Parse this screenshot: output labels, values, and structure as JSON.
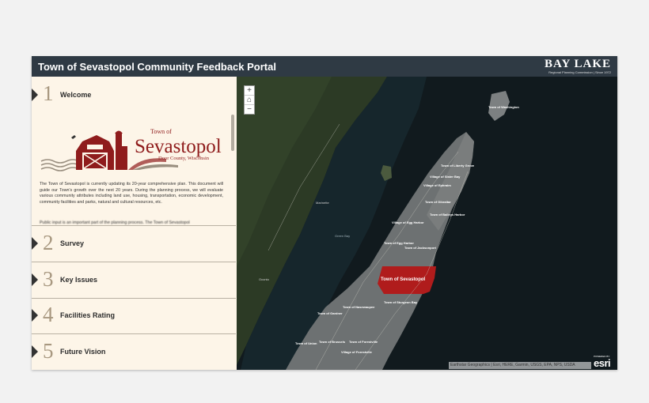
{
  "header": {
    "title": "Town of Sevastopol Community Feedback Portal",
    "logo_brand": "BAY LAKE",
    "logo_sub": "Regional Planning Commission | Since 1972"
  },
  "steps": [
    {
      "number": "1",
      "label": "Welcome"
    },
    {
      "number": "2",
      "label": "Survey"
    },
    {
      "number": "3",
      "label": "Key Issues"
    },
    {
      "number": "4",
      "label": "Facilities Rating"
    },
    {
      "number": "5",
      "label": "Future Vision"
    }
  ],
  "welcome": {
    "logo_town_of": "Town of",
    "logo_name": "Sevastopol",
    "logo_county": "Door County, Wisconsin",
    "description": "The Town of Sevastopol is currently updating its 20-year comprehensive plan. This document will guide our Town's growth over the next 20 years. During the planning process, we will evaluate various community attributes including land use, housing, transportation, economic development, community facilities and parks, natural and cultural resources, etc.",
    "description_more": "Public input is an important part of the planning process. The Town of Sevastopol"
  },
  "map": {
    "zoom_in": "+",
    "home": "⌂",
    "zoom_out": "−",
    "highlight_color": "#b01c1c",
    "highlight_label": "Town of Sevastopol",
    "labels": [
      "Town of Washington",
      "Town of Liberty Grove",
      "Village of Sister Bay",
      "Village of Ephraim",
      "Town of Gibraltar",
      "Town of Baileys Harbor",
      "Village of Egg Harbor",
      "Town of Egg Harbor",
      "Town of Jacksonport",
      "Town of Sturgeon Bay",
      "Town of Nasewaupee",
      "Town of Gardner",
      "Town of Union",
      "Town of Brussels",
      "Town of Forestville",
      "Village of Forestville"
    ],
    "place_labels": [
      "Green Bay",
      "Oconto",
      "Marinette"
    ],
    "attribution": "Earthstar Geographics | Esri, HERE, Garmin, USGS, EPA, NPS, USDA",
    "esri_powered": "POWERED BY",
    "esri_name": "esri"
  }
}
